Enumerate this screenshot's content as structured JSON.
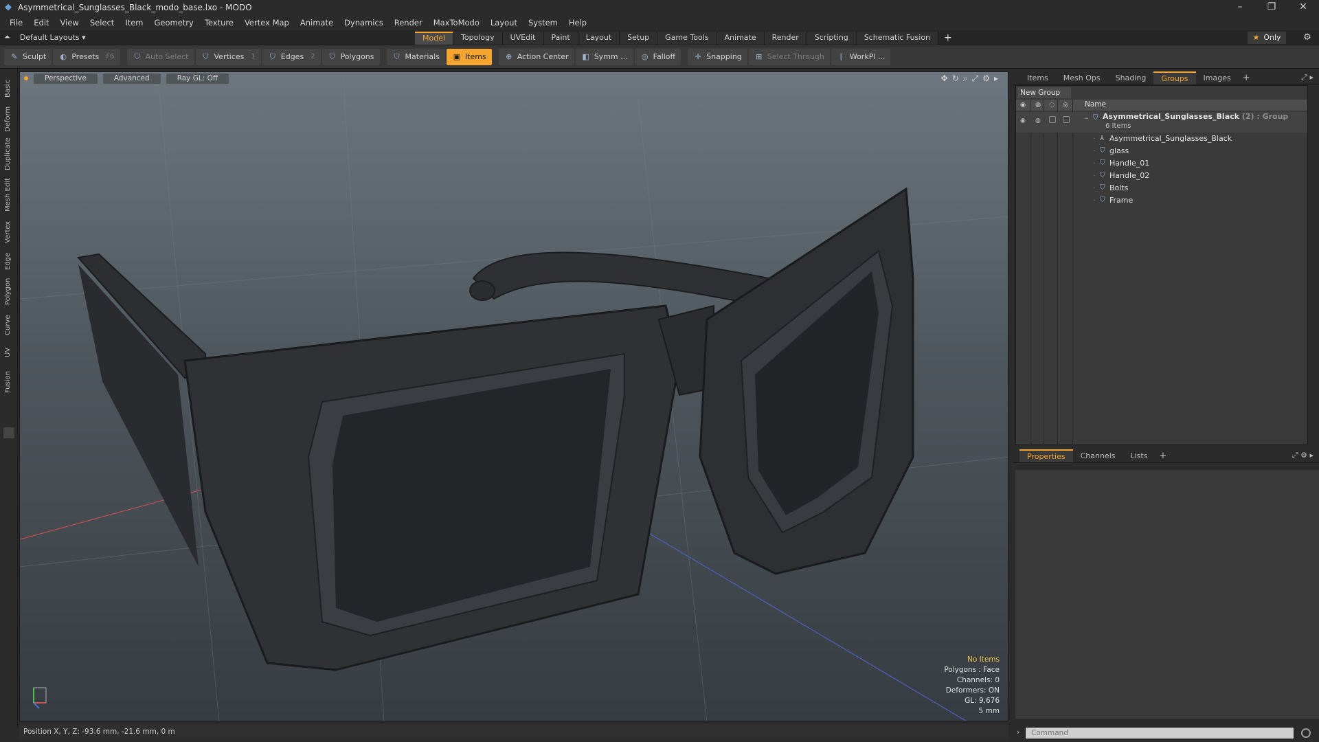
{
  "window": {
    "title": "Asymmetrical_Sunglasses_Black_modo_base.lxo - MODO",
    "controls": [
      "–",
      "❐",
      "✕"
    ]
  },
  "menu": [
    "File",
    "Edit",
    "View",
    "Select",
    "Item",
    "Geometry",
    "Texture",
    "Vertex Map",
    "Animate",
    "Dynamics",
    "Render",
    "MaxToModo",
    "Layout",
    "System",
    "Help"
  ],
  "layoutbar": {
    "layout_dropdown": "Default Layouts ▾",
    "tabs": [
      "Model",
      "Topology",
      "UVEdit",
      "Paint",
      "Layout",
      "Setup",
      "Game Tools",
      "Animate",
      "Render",
      "Scripting",
      "Schematic Fusion"
    ],
    "active_tab": "Model",
    "only_label": "Only"
  },
  "toolbar": {
    "sculpt": "Sculpt",
    "presets": "Presets",
    "presets_key": "F6",
    "auto_select": "Auto Select",
    "vertices": "Vertices",
    "vertices_count": "1",
    "edges": "Edges",
    "edges_count": "2",
    "polygons": "Polygons",
    "materials": "Materials",
    "items": "Items",
    "action_center": "Action Center",
    "symm": "Symm ...",
    "falloff": "Falloff",
    "snapping": "Snapping",
    "select_through": "Select Through",
    "workplane": "WorkPl ..."
  },
  "left_tabs": [
    "Basic",
    "Deform",
    "Duplicate",
    "Mesh Edit",
    "Vertex",
    "Edge",
    "Polygon",
    "Curve",
    "UV",
    "Fusion"
  ],
  "viewport": {
    "view_mode": "Perspective",
    "shading": "Advanced",
    "raygl": "Ray GL: Off",
    "info": {
      "selection": "No Items",
      "polygons": "Polygons : Face",
      "channels": "Channels: 0",
      "deformers": "Deformers: ON",
      "gl": "GL: 9,676",
      "unit": "5 mm"
    }
  },
  "statusbar": {
    "position": "Position X, Y, Z:  -93.6 mm, -21.6 mm, 0 m"
  },
  "groups_panel": {
    "tabs": [
      "Items",
      "Mesh Ops",
      "Shading",
      "Groups",
      "Images"
    ],
    "active_tab": "Groups",
    "new_group": "New Group",
    "name_header": "Name",
    "group": {
      "name": "Asymmetrical_Sunglasses_Black",
      "tag": "(2) : Group",
      "count": "6 Items"
    },
    "items": [
      "Asymmetrical_Sunglasses_Black",
      "glass",
      "Handle_01",
      "Handle_02",
      "Bolts",
      "Frame"
    ]
  },
  "props_panel": {
    "tabs": [
      "Properties",
      "Channels",
      "Lists"
    ],
    "active_tab": "Properties"
  },
  "command": {
    "placeholder": "Command"
  },
  "colors": {
    "accent": "#f3a530",
    "panel": "#3a3a3a",
    "background": "#2b2b2b"
  }
}
